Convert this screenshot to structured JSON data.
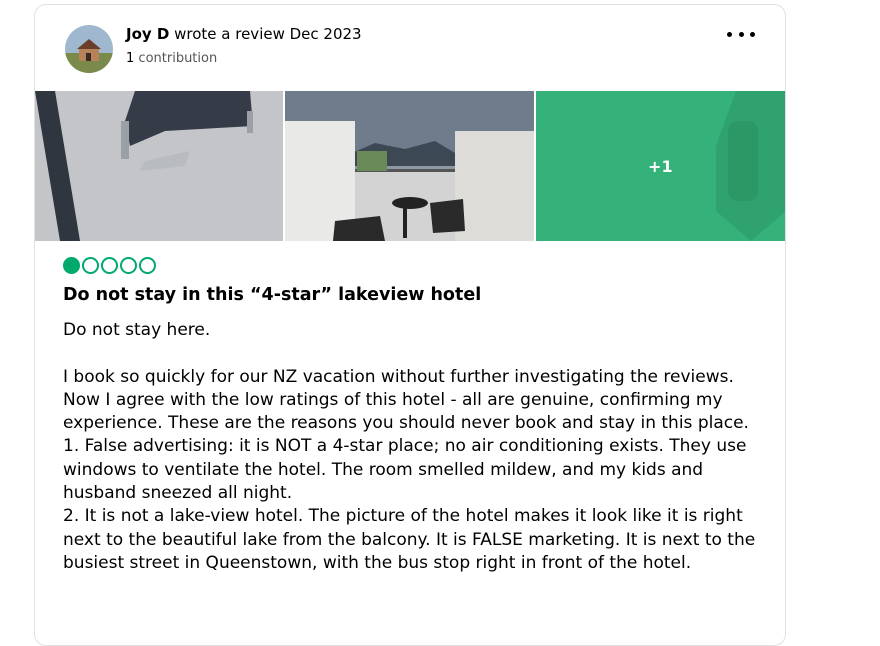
{
  "review": {
    "author": "Joy D",
    "wrote_text": "wrote a review Dec 2023",
    "contrib_count": "1",
    "contrib_label": "contribution",
    "more_photos_label": "+1",
    "rating": 1,
    "rating_max": 5,
    "title": "Do not stay in this “4-star” lakeview hotel",
    "body_first": "Do not stay here.",
    "body_lines": [
      "I book so quickly for our NZ vacation without further investigating the reviews.",
      "Now I agree with the low ratings of this hotel - all are genuine, confirming my",
      "experience. These are the reasons you should never book and stay in this place.",
      "1. False advertising: it is NOT a 4-star place; no air conditioning exists. They use",
      "windows to ventilate the hotel. The room smelled mildew, and my kids and",
      "husband sneezed all night.",
      "2. It is not a lake-view hotel. The picture of the hotel makes it look like it is right",
      "next to the beautiful lake from the balcony. It is FALSE marketing. It is next to the",
      "busiest street in Queenstown, with the bus stop right in front of the hotel."
    ]
  },
  "colors": {
    "bubble": "#00aa6c",
    "overlay": "#34b27a"
  },
  "icons": {
    "menu": "more-horizontal-icon",
    "rating": "bubble-rating"
  }
}
